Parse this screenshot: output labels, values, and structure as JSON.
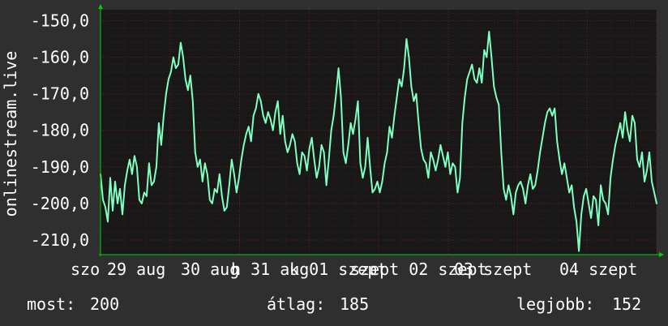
{
  "chart_data": {
    "type": "line",
    "side_label": "onlinestream.live",
    "ylim": [
      -214,
      -147
    ],
    "y_ticks": [
      "-150,0",
      "-160,0",
      "-170,0",
      "-180,0",
      "-190,0",
      "-200,0",
      "-210,0"
    ],
    "y_tick_values": [
      -150,
      -160,
      -170,
      -180,
      -190,
      -200,
      -210
    ],
    "x_tick_labels": [
      "szo",
      "29 aug",
      "30 aug",
      "h 31 aug",
      "k 01 szept",
      "szept 02 szept",
      "03 szept",
      "04 szept"
    ],
    "grid": true,
    "series": [
      {
        "values": [
          -192,
          -199,
          -201,
          -205,
          -193,
          -202,
          -194,
          -200,
          -196,
          -203,
          -195,
          -191,
          -188,
          -192,
          -187,
          -190,
          -199,
          -200,
          -197,
          -198,
          -189,
          -195,
          -194,
          -190,
          -178,
          -184,
          -176,
          -170,
          -166,
          -164,
          -160,
          -163,
          -162,
          -156,
          -160,
          -166,
          -169,
          -165,
          -172,
          -186,
          -190,
          -188,
          -194,
          -189,
          -192,
          -199,
          -200,
          -196,
          -197,
          -192,
          -198,
          -202,
          -201,
          -195,
          -188,
          -192,
          -197,
          -193,
          -188,
          -184,
          -181,
          -179,
          -183,
          -176,
          -174,
          -170,
          -172,
          -176,
          -178,
          -175,
          -177,
          -180,
          -175,
          -172,
          -181,
          -176,
          -183,
          -186,
          -184,
          -181,
          -183,
          -189,
          -192,
          -186,
          -187,
          -191,
          -185,
          -182,
          -188,
          -193,
          -190,
          -184,
          -186,
          -195,
          -188,
          -180,
          -176,
          -170,
          -163,
          -171,
          -186,
          -189,
          -184,
          -178,
          -181,
          -177,
          -172,
          -189,
          -193,
          -190,
          -182,
          -190,
          -197,
          -196,
          -194,
          -197,
          -194,
          -189,
          -186,
          -179,
          -182,
          -176,
          -171,
          -166,
          -168,
          -163,
          -155,
          -160,
          -168,
          -172,
          -170,
          -178,
          -185,
          -188,
          -189,
          -193,
          -186,
          -188,
          -191,
          -188,
          -184,
          -187,
          -190,
          -186,
          -192,
          -189,
          -190,
          -197,
          -193,
          -178,
          -171,
          -166,
          -164,
          -162,
          -166,
          -167,
          -163,
          -167,
          -158,
          -160,
          -153,
          -160,
          -168,
          -171,
          -173,
          -186,
          -196,
          -199,
          -195,
          -198,
          -203,
          -197,
          -195,
          -194,
          -196,
          -200,
          -195,
          -192,
          -196,
          -195,
          -191,
          -186,
          -182,
          -178,
          -175,
          -174,
          -176,
          -174,
          -183,
          -188,
          -192,
          -189,
          -193,
          -197,
          -195,
          -201,
          -205,
          -213,
          -203,
          -198,
          -196,
          -200,
          -204,
          -198,
          -199,
          -206,
          -195,
          -199,
          -200,
          -203,
          -193,
          -188,
          -184,
          -181,
          -178,
          -182,
          -175,
          -180,
          -183,
          -176,
          -178,
          -188,
          -190,
          -186,
          -194,
          -191,
          -186,
          -194,
          -197,
          -200
        ]
      }
    ],
    "stats": {
      "most_label": "most:",
      "most_value": "200",
      "atlag_label": "átlag:",
      "atlag_value": "185",
      "legjobb_label": "legjobb:",
      "legjobb_value": "152"
    }
  },
  "colors": {
    "background": "#2f2f2f",
    "plot_background": "#181818",
    "series": "#7fffc0",
    "axis_arrow": "#00d000",
    "grid": "#c02020",
    "text": "#ffffff"
  }
}
